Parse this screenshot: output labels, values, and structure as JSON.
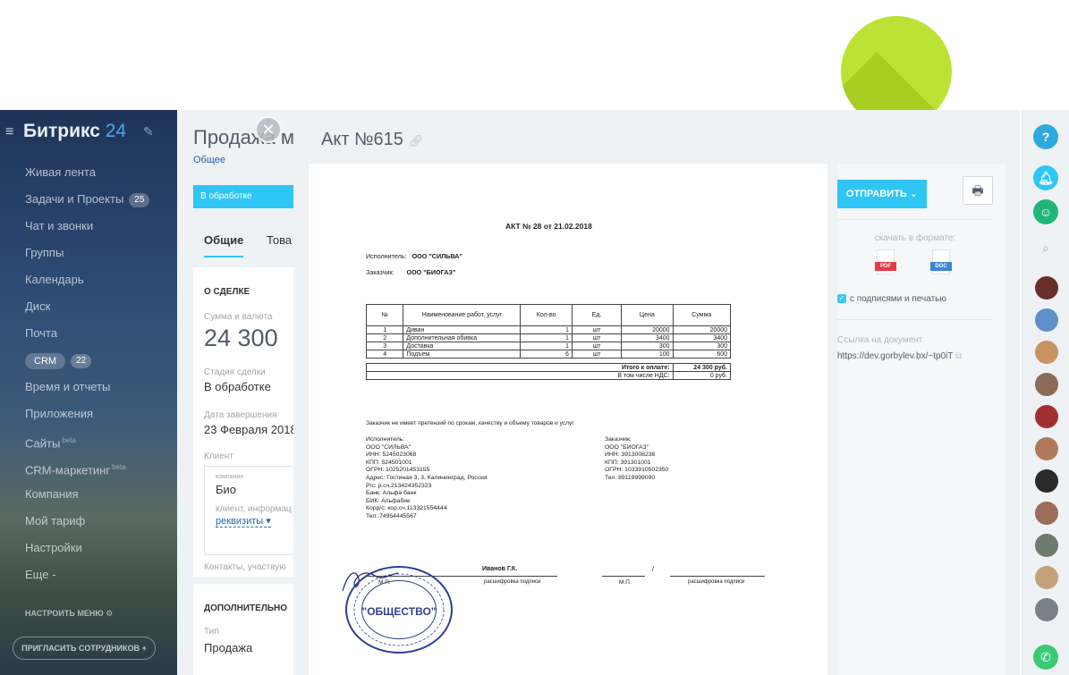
{
  "sidebar": {
    "logo_text": "Битрикс",
    "logo_num": "24",
    "items": [
      {
        "label": "Живая лента"
      },
      {
        "label": "Задачи и Проекты",
        "count": "25"
      },
      {
        "label": "Чат и звонки"
      },
      {
        "label": "Группы"
      },
      {
        "label": "Календарь"
      },
      {
        "label": "Диск"
      },
      {
        "label": "Почта"
      },
      {
        "label": "CRM",
        "count": "22"
      },
      {
        "label": "Время и отчеты"
      },
      {
        "label": "Приложения"
      },
      {
        "label": "Сайты",
        "badge": "beta"
      },
      {
        "label": "CRM-маркетинг",
        "badge": "beta"
      },
      {
        "label": "Компания"
      },
      {
        "label": "Мой тариф"
      },
      {
        "label": "Настройки"
      },
      {
        "label": "Еще -"
      }
    ],
    "settings_label": "НАСТРОИТЬ МЕНЮ",
    "invite_label": "ПРИГЛАСИТЬ СОТРУДНИКОВ +"
  },
  "deal": {
    "title": "Продажа м",
    "subtitle": "Общее",
    "stage_bar": "В обработке",
    "tab_general": "Общие",
    "tab_goods": "Това",
    "section_about": "О СДЕЛКЕ",
    "sum_label": "Сумма и валюта",
    "sum_value": "24 300",
    "stage_label": "Стадия сделки",
    "stage_value": "В обработке",
    "close_label": "Дата завершения",
    "close_value": "23 Февраля 2018",
    "client_label": "Клиент",
    "company_label": "компания",
    "company_value": "Био",
    "client_info": "клиент, информац",
    "requisites": "реквизиты",
    "contacts": "Контакты, участвую",
    "section_extra": "ДОПОЛНИТЕЛЬНО",
    "type_label": "Тип",
    "type_value": "Продажа"
  },
  "slider": {
    "title": "Акт №615"
  },
  "document": {
    "heading": "АКТ № 28 от 21.02.2018",
    "executor_label": "Исполнитель:",
    "executor_value": "ООО \"СИЛЬВА\"",
    "customer_label": "Заказчик:",
    "customer_value": "ООО \"БИОГАЗ\"",
    "columns": [
      "№",
      "Наименование работ, услуг",
      "Кол-во",
      "Ед.",
      "Цена",
      "Сумма"
    ],
    "rows": [
      [
        "1",
        "Диван",
        "1",
        "шт",
        "20000",
        "20000"
      ],
      [
        "2",
        "Дополнительная обивка",
        "1",
        "шт",
        "3400",
        "3400"
      ],
      [
        "3",
        "Доставка",
        "1",
        "шт",
        "300",
        "300"
      ],
      [
        "4",
        "Подъем",
        "6",
        "шт",
        "100",
        "600"
      ]
    ],
    "total_label": "Итого к оплате:",
    "total_value": "24 300 руб.",
    "vat_label": "В том числе НДС:",
    "vat_value": "0 руб.",
    "notice": "Заказчик не имеет претензий по срокам, качеству и объему товаров и услуг.",
    "exec_block": [
      "Исполнитель:",
      "ООО \"СИЛЬВА\"",
      "ИНН: 5245023068",
      "КПП: 524501001",
      "ОГРН: 1025201453155",
      "Адрес: Гостиная 3, 3, Калининград, Россия",
      "Р/с: р.сч.213424352323",
      "Банк: Альфа банк",
      "БИК: Альфабик",
      "Корр/с: кор.сч.113321554444",
      "Тел.:74954445567"
    ],
    "cust_block": [
      "Заказчик:",
      "ООО \"БИОГАЗ\"",
      "ИНН: 3913008238",
      "КПП: 391301001",
      "ОГРН: 1033910502350",
      "Тел.:89119999090"
    ],
    "signer": "Иванов Г.К.",
    "mp": "М.П.",
    "decode_sig": "расшифровка подписи",
    "seal_text": "\"ОБЩЕСТВО\""
  },
  "pane": {
    "send_label": "ОТПРАВИТЬ",
    "download_label": "скачать в формате:",
    "pdf_label": "PDF",
    "doc_label": "DOC",
    "checkbox_label": "с подписями и печатью",
    "link_label": "Ссылка на документ",
    "link_value": "https://dev.gorbylev.bx/~tp0iT"
  },
  "colors": {
    "accent": "#2fc6f6",
    "lime": "#bde236",
    "green_call": "#55d0a0"
  },
  "icons": [
    "menu-icon",
    "pencil-icon",
    "close-icon",
    "link-icon",
    "chevron-down-icon",
    "print-icon",
    "pdf-file-icon",
    "doc-file-icon",
    "external-link-icon",
    "help-icon",
    "bell-icon",
    "chat-icon",
    "search-icon",
    "phone-icon"
  ]
}
